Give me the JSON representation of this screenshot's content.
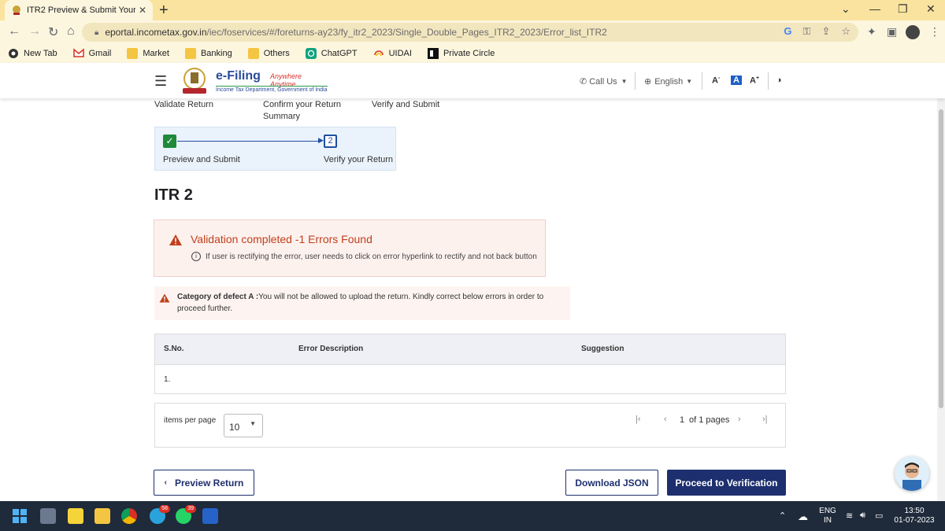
{
  "browser": {
    "tab_title": "ITR2 Preview & Submit Your Retu",
    "url_host": "eportal.incometax.gov.in",
    "url_path": "/iec/foservices/#/foreturns-ay23/fy_itr2_2023/Single_Double_Pages_ITR2_2023/Error_list_ITR2",
    "bookmarks": [
      "New Tab",
      "Gmail",
      "Market",
      "Banking",
      "Others",
      "ChatGPT",
      "UIDAI",
      "Private Circle"
    ]
  },
  "header": {
    "logo_title": "e-Filing",
    "logo_tagline": "Anywhere Anytime",
    "logo_sub": "Income Tax Department, Government of India",
    "call_us": "Call Us",
    "language": "English",
    "font_decrease": "A",
    "font_normal": "A",
    "font_increase": "A"
  },
  "steps": {
    "top": [
      "Validate Return",
      "Confirm your Return Summary",
      "Verify and Submit"
    ],
    "sub": [
      "Preview and Submit",
      "Verify your Return"
    ],
    "current_num": "2"
  },
  "page_title": "ITR 2",
  "error_box": {
    "title": "Validation completed -1  Errors Found",
    "info": "If user is rectifying the error, user needs to click on error hyperlink to rectify and not back button"
  },
  "defect": {
    "label": "Category of defect A :",
    "text": "You will not be allowed to upload the return. Kindly correct below errors in order to proceed further."
  },
  "table": {
    "headers": [
      "S.No.",
      "Error Description",
      "Suggestion"
    ],
    "rows": [
      [
        "1.",
        "",
        ""
      ]
    ]
  },
  "paginator": {
    "items_per_page_label": "items per page",
    "items_per_page_value": "10",
    "current_page": "1",
    "page_text": "of 1 pages"
  },
  "buttons": {
    "preview": "Preview Return",
    "download": "Download JSON",
    "proceed": "Proceed to Verification"
  },
  "taskbar": {
    "lang_top": "ENG",
    "lang_bottom": "IN",
    "time": "13:50",
    "date": "01-07-2023",
    "telegram_badge": "58",
    "whatsapp_badge": "39"
  },
  "colors": {
    "primary": "#1d2f6f",
    "error": "#c0401d",
    "success": "#1e8a3a",
    "tab_bar": "#f9e39e"
  }
}
